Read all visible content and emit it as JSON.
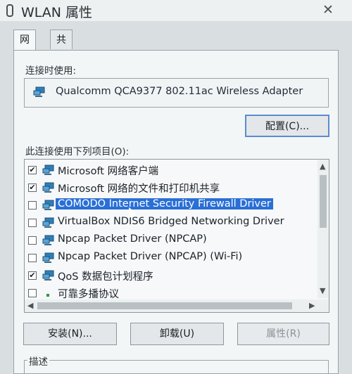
{
  "window": {
    "title": "WLAN 属性",
    "close_symbol": "✕"
  },
  "tabs": [
    {
      "label": "网络",
      "active": true
    },
    {
      "label": "共享",
      "active": false
    }
  ],
  "connect_using": {
    "label": "连接时使用:",
    "adapter": "Qualcomm QCA9377 802.11ac Wireless Adapter",
    "adapter_icon": "network-adapter-icon",
    "configure_button": "配置(C)..."
  },
  "items_section": {
    "label": "此连接使用下列项目(O):",
    "items": [
      {
        "label": "Microsoft 网络客户端",
        "checked": true,
        "selected": false,
        "icon": "network-client-icon"
      },
      {
        "label": "Microsoft 网络的文件和打印机共享",
        "checked": true,
        "selected": false,
        "icon": "network-client-icon"
      },
      {
        "label": "COMODO Internet Security Firewall Driver",
        "checked": false,
        "selected": true,
        "icon": "network-client-icon"
      },
      {
        "label": "VirtualBox NDIS6 Bridged Networking Driver",
        "checked": false,
        "selected": false,
        "icon": "network-client-icon"
      },
      {
        "label": "Npcap Packet Driver (NPCAP)",
        "checked": false,
        "selected": false,
        "icon": "network-client-icon"
      },
      {
        "label": "Npcap Packet Driver (NPCAP) (Wi-Fi)",
        "checked": false,
        "selected": false,
        "icon": "network-client-icon"
      },
      {
        "label": "QoS 数据包计划程序",
        "checked": true,
        "selected": false,
        "icon": "network-client-icon"
      },
      {
        "label": "可靠多播协议",
        "checked": false,
        "selected": false,
        "icon": "protocol-icon"
      }
    ]
  },
  "buttons": {
    "install": "安装(N)...",
    "uninstall": "卸载(U)",
    "properties": "属性(R)"
  },
  "description": {
    "label": "描述"
  },
  "colors": {
    "selection": "#2a6fd6",
    "focus_border": "#5b8bd0"
  }
}
